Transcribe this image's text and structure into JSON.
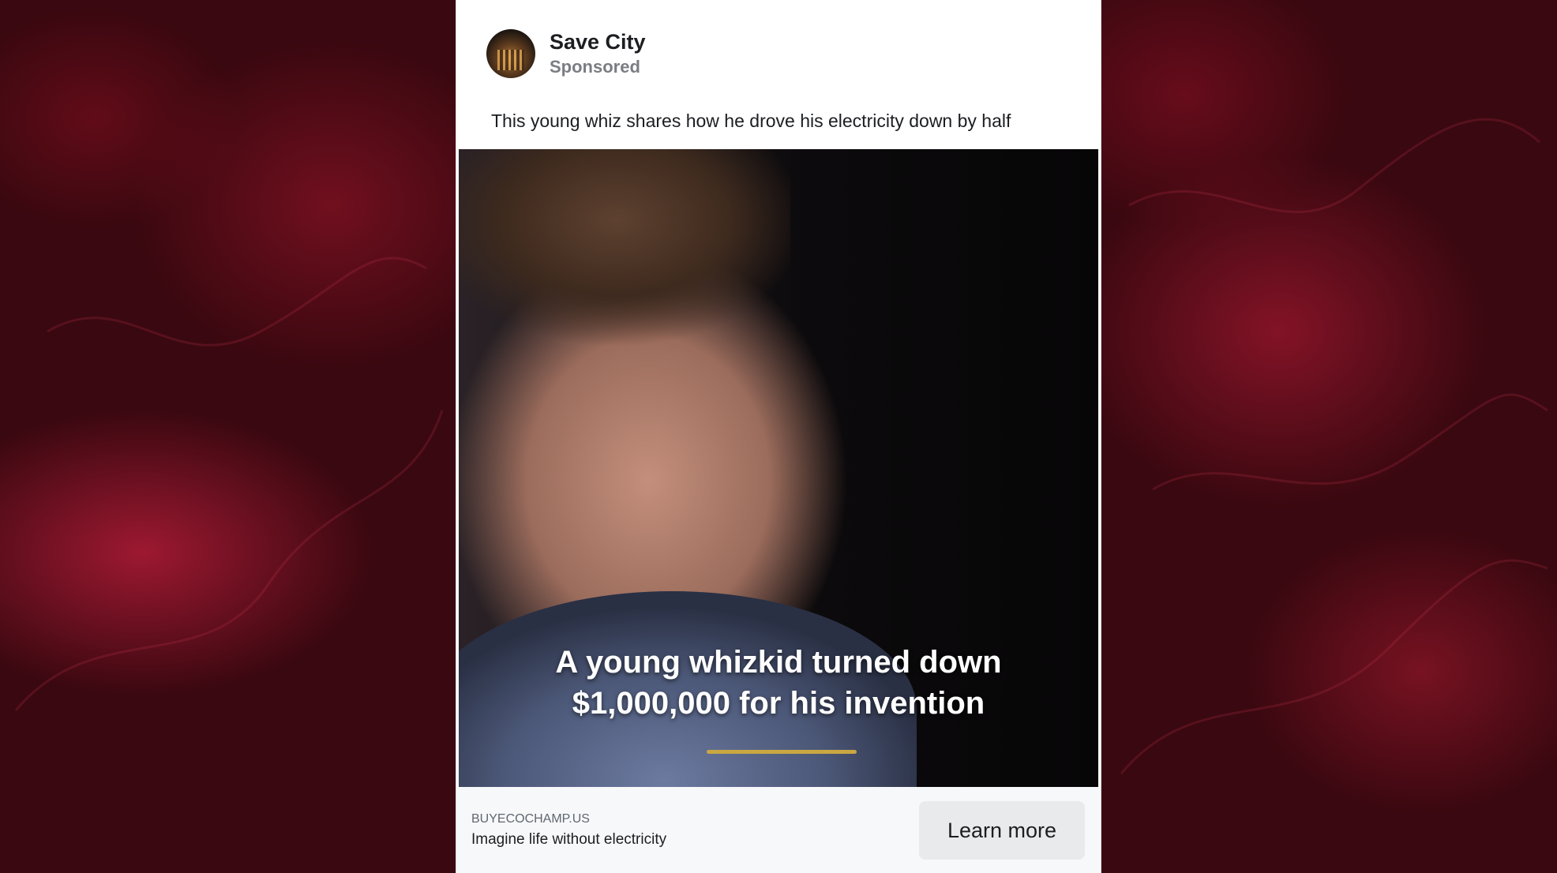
{
  "post": {
    "page_name": "Save City",
    "sponsored_label": "Sponsored",
    "caption": "This young whiz shares how he drove his electricity down by half"
  },
  "media": {
    "overlay_line1": "A young whizkid turned down",
    "overlay_line2": "$1,000,000 for his invention"
  },
  "footer": {
    "domain": "BUYECOCHAMP.US",
    "headline": "Imagine life without electricity",
    "cta_label": "Learn more"
  },
  "colors": {
    "background": "#3a0810",
    "progress_accent": "#c9a742",
    "cta_background": "#e9eaec"
  }
}
